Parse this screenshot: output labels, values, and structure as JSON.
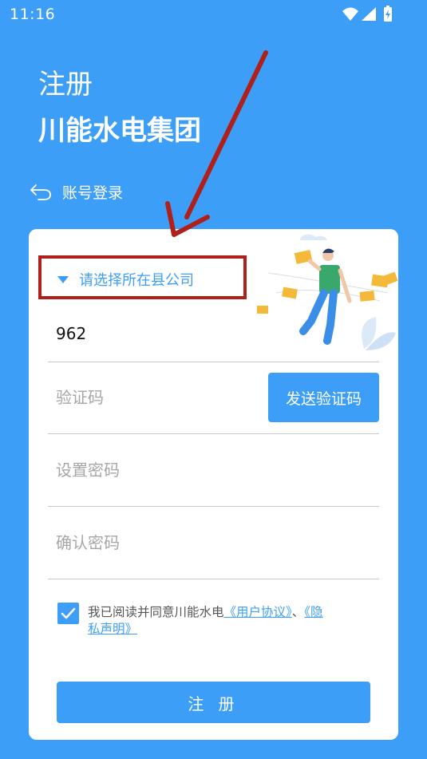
{
  "status_bar": {
    "time": "11:16",
    "icons": [
      "wifi-icon",
      "signal-icon",
      "battery-icon"
    ]
  },
  "header": {
    "title": "注册",
    "company": "川能水电集团"
  },
  "back_link": {
    "label": "账号登录",
    "icon": "back-icon"
  },
  "form": {
    "county_select": {
      "label": "请选择所在县公司"
    },
    "phone": {
      "value": "962"
    },
    "code": {
      "placeholder": "验证码",
      "send_button": "发送验证码"
    },
    "password": {
      "placeholder": "设置密码"
    },
    "confirm_password": {
      "placeholder": "确认密码"
    },
    "agreement": {
      "checked": true,
      "text": "我已阅读并同意川能水电",
      "user_agreement": "《用户协议》",
      "separator": "、",
      "privacy_part1": "《隐",
      "privacy_part2": "私声明》"
    },
    "submit_label": "注 册"
  },
  "colors": {
    "primary": "#3d9ef7",
    "annotation": "#b0201b"
  }
}
